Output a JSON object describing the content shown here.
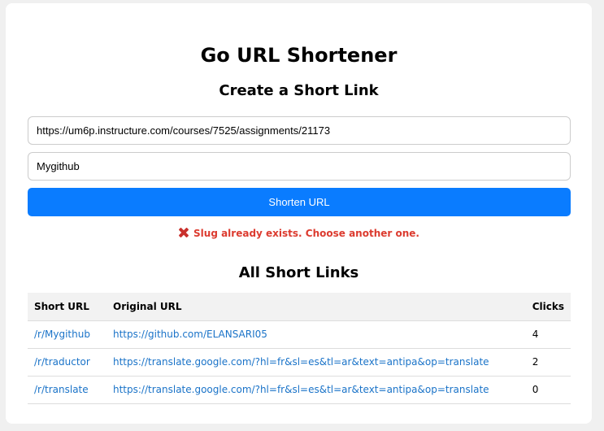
{
  "app": {
    "title": "Go URL Shortener",
    "create_heading": "Create a Short Link"
  },
  "form": {
    "url_value": "https://um6p.instructure.com/courses/7525/assignments/21173",
    "slug_value": "Mygithub",
    "submit_label": "Shorten URL"
  },
  "error": {
    "message": "Slug already exists. Choose another one.",
    "icon": "cross-icon",
    "color": "#dc3b2f"
  },
  "links": {
    "heading": "All Short Links",
    "columns": [
      "Short URL",
      "Original URL",
      "Clicks"
    ],
    "rows": [
      {
        "short": "/r/Mygithub",
        "original": "https://github.com/ELANSARI05",
        "clicks": "4"
      },
      {
        "short": "/r/traductor",
        "original": "https://translate.google.com/?hl=fr&sl=es&tl=ar&text=antipa&op=translate",
        "clicks": "2"
      },
      {
        "short": "/r/translate",
        "original": "https://translate.google.com/?hl=fr&sl=es&tl=ar&text=antipa&op=translate",
        "clicks": "0"
      }
    ]
  },
  "colors": {
    "accent": "#0a7cff",
    "link": "#1a73c8"
  }
}
